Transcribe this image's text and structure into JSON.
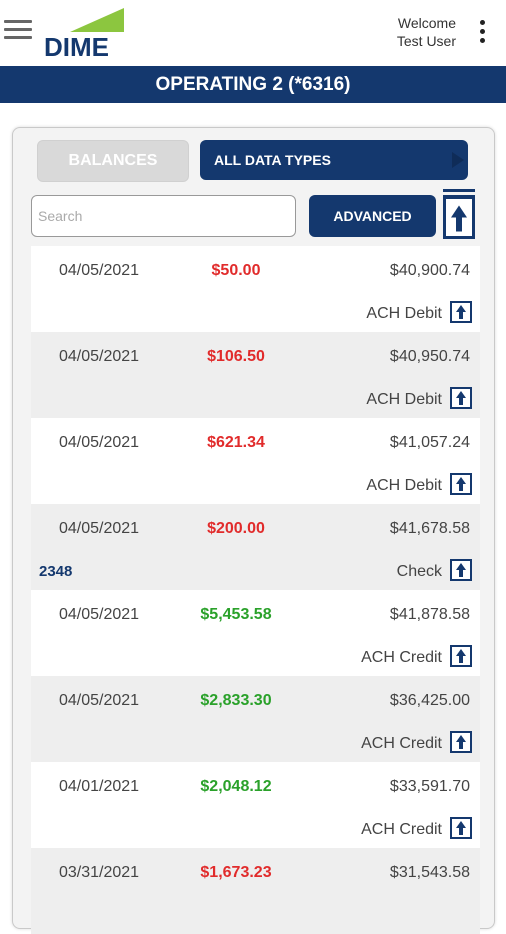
{
  "header": {
    "welcome": "Welcome",
    "user": "Test User",
    "account_title": "OPERATING 2 (*6316)",
    "colors": {
      "brand": "#14386e",
      "logo_green": "#8cc63f"
    }
  },
  "tabs": {
    "balances_label": "BALANCES",
    "types_label": "ALL DATA TYPES"
  },
  "search": {
    "placeholder": "Search",
    "advanced_label": "ADVANCED"
  },
  "transactions": [
    {
      "date": "04/05/2021",
      "amount": "$50.00",
      "kind": "debit",
      "balance": "$40,900.74",
      "type": "ACH Debit",
      "check": ""
    },
    {
      "date": "04/05/2021",
      "amount": "$106.50",
      "kind": "debit",
      "balance": "$40,950.74",
      "type": "ACH Debit",
      "check": ""
    },
    {
      "date": "04/05/2021",
      "amount": "$621.34",
      "kind": "debit",
      "balance": "$41,057.24",
      "type": "ACH Debit",
      "check": ""
    },
    {
      "date": "04/05/2021",
      "amount": "$200.00",
      "kind": "debit",
      "balance": "$41,678.58",
      "type": "Check",
      "check": "2348"
    },
    {
      "date": "04/05/2021",
      "amount": "$5,453.58",
      "kind": "credit",
      "balance": "$41,878.58",
      "type": "ACH Credit",
      "check": ""
    },
    {
      "date": "04/05/2021",
      "amount": "$2,833.30",
      "kind": "credit",
      "balance": "$36,425.00",
      "type": "ACH Credit",
      "check": ""
    },
    {
      "date": "04/01/2021",
      "amount": "$2,048.12",
      "kind": "credit",
      "balance": "$33,591.70",
      "type": "ACH Credit",
      "check": ""
    },
    {
      "date": "03/31/2021",
      "amount": "$1,673.23",
      "kind": "debit",
      "balance": "$31,543.58",
      "type": "",
      "check": ""
    }
  ]
}
